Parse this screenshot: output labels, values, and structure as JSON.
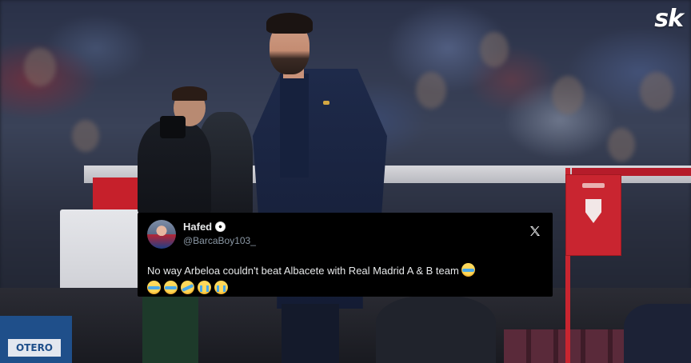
{
  "watermark": {
    "logo_text": "sk"
  },
  "tweet": {
    "display_name": "Hafed",
    "handle": "@BarcaBoy103_",
    "text": "No way Arbeloa couldn't beat Albacete with Real Madrid A & B team",
    "emojis": [
      "face-with-tears-of-joy",
      "face-with-tears-of-joy",
      "face-with-tears-of-joy",
      "rolling-on-floor-laughing",
      "loudly-crying-face",
      "loudly-crying-face"
    ],
    "name_badge_icon": "soccer-ball-icon",
    "platform_icon": "x-logo-icon"
  },
  "background": {
    "signage_text": "OTERO"
  },
  "colors": {
    "card_bg": "#000000",
    "name_text": "#e7e9ea",
    "handle_text": "#8b98a5",
    "club_red": "#c92530"
  }
}
